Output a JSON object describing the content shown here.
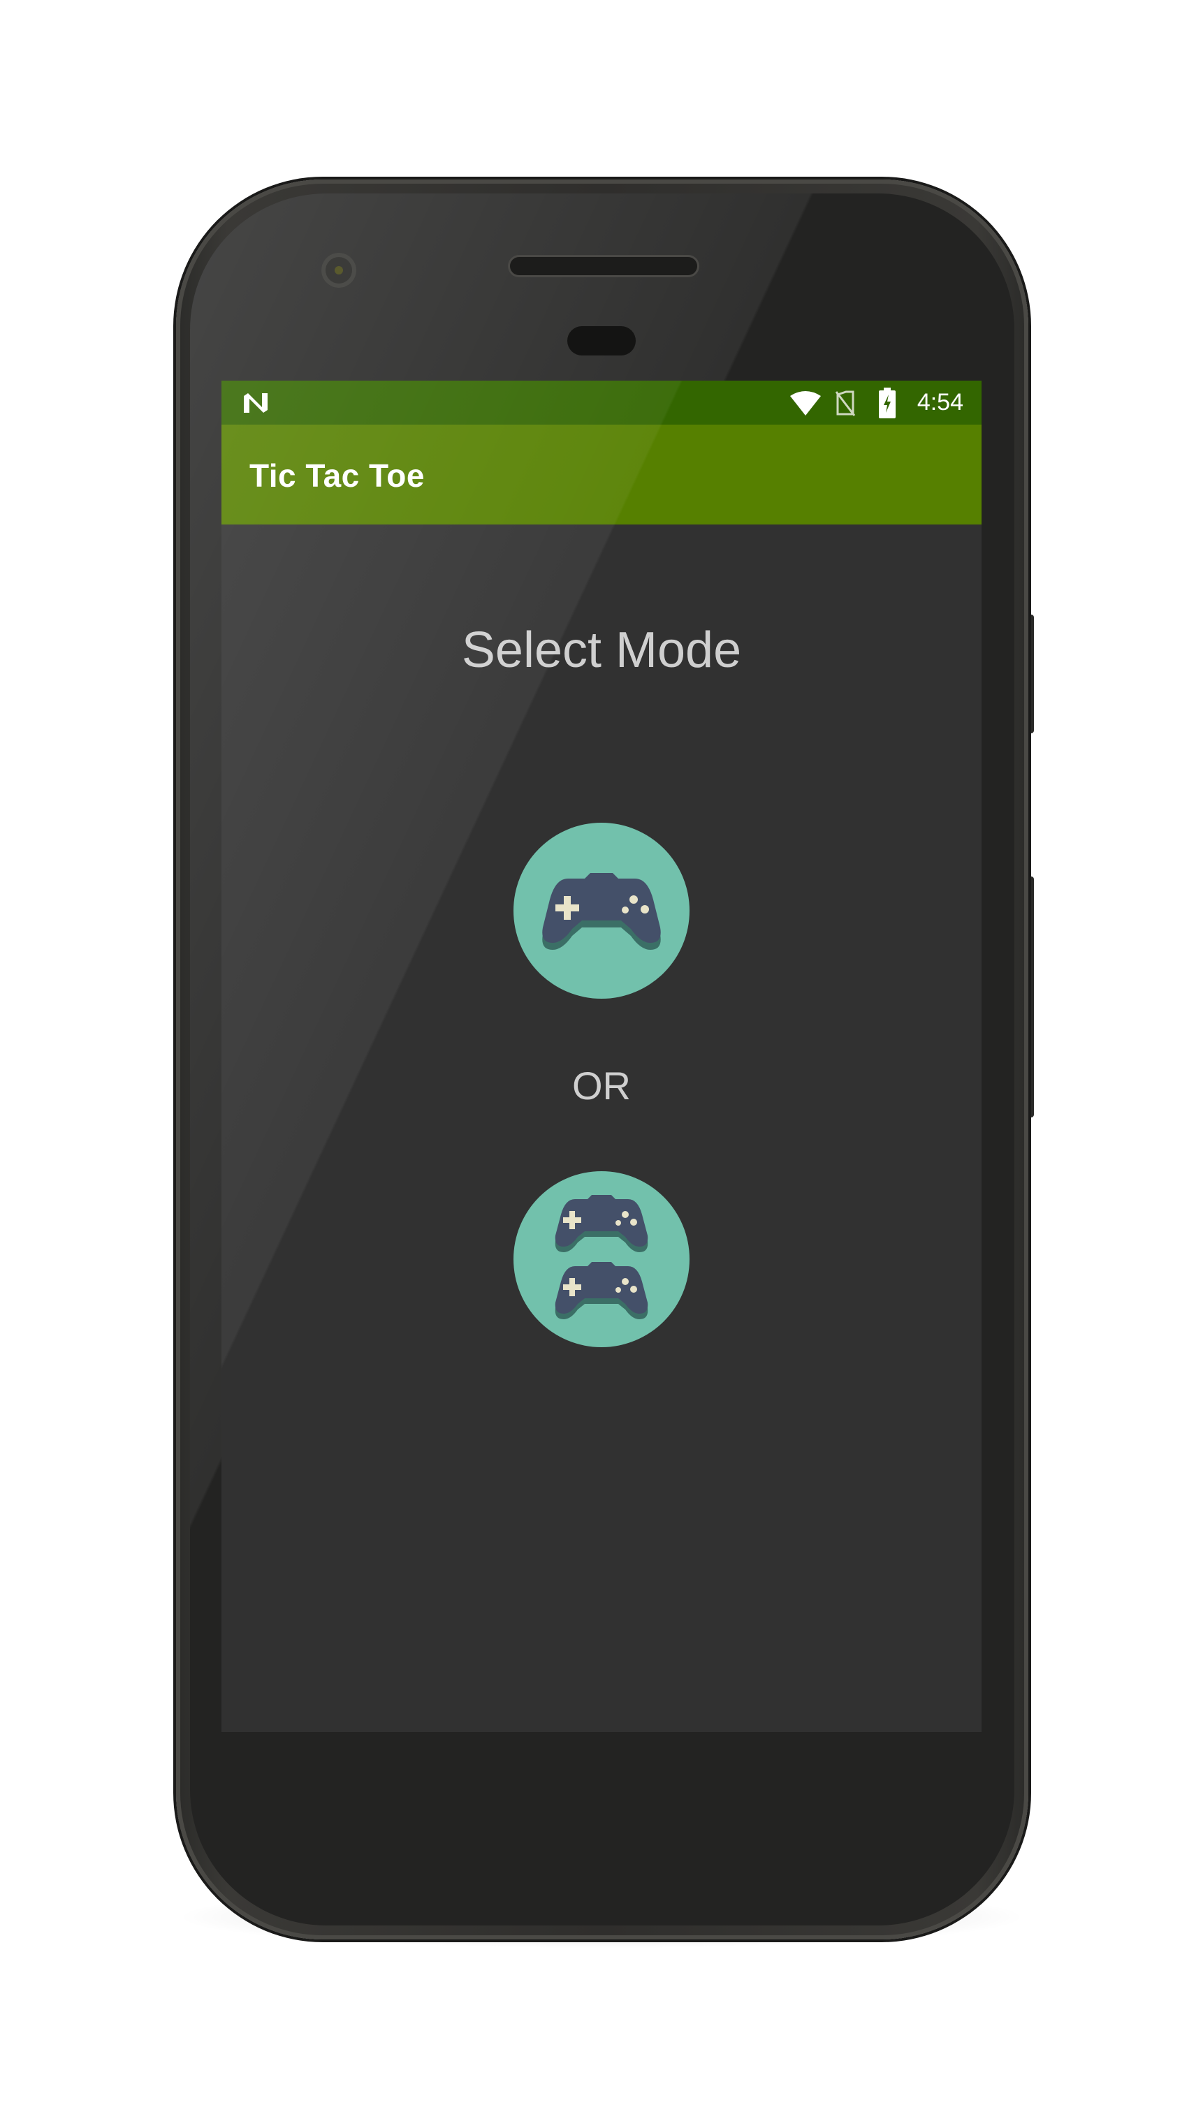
{
  "status_bar": {
    "time": "4:54",
    "icons": [
      "n-notification-icon",
      "wifi-icon",
      "no-sim-icon",
      "battery-charging-icon"
    ]
  },
  "app_bar": {
    "title": "Tic Tac Toe"
  },
  "main": {
    "heading": "Select Mode",
    "single_player_icon": "gamepad-icon",
    "separator": "OR",
    "two_player_icon": "two-gamepads-icon"
  },
  "colors": {
    "status_bar": "#336600",
    "app_bar": "#568000",
    "screen_background": "#313131",
    "mode_button": "#72c1ac",
    "gamepad": "#445069",
    "gamepad_shadow": "#3b6f66",
    "gamepad_buttons": "#e9e4c9"
  }
}
